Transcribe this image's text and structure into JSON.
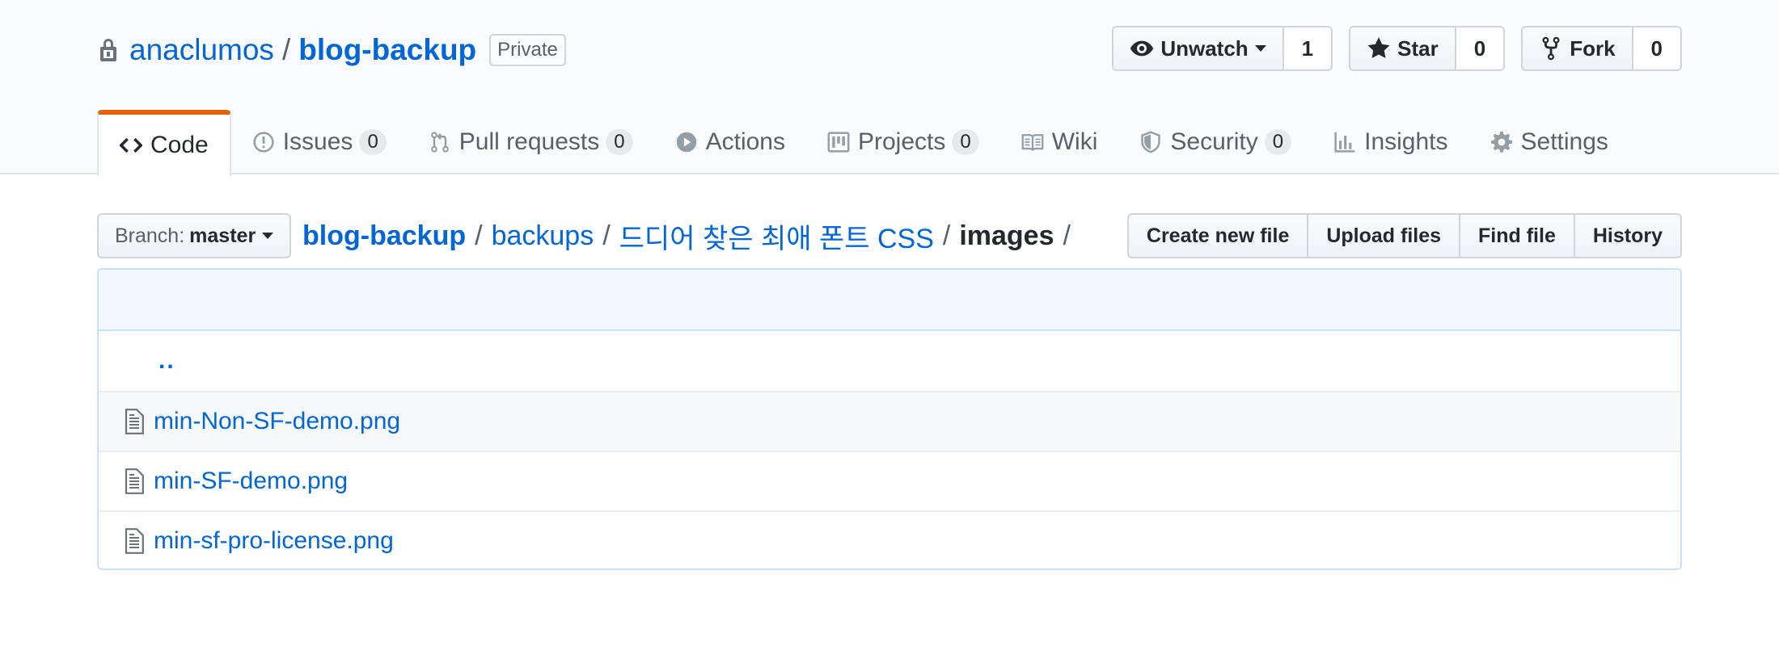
{
  "repo": {
    "owner": "anaclumos",
    "separator": "/",
    "name": "blog-backup",
    "visibility": "Private"
  },
  "actions": {
    "watch_label": "Unwatch",
    "watch_count": "1",
    "star_label": "Star",
    "star_count": "0",
    "fork_label": "Fork",
    "fork_count": "0"
  },
  "nav": {
    "tabs": [
      {
        "label": "Code",
        "icon": "code-icon",
        "selected": true
      },
      {
        "label": "Issues",
        "icon": "issue-icon",
        "count": "0"
      },
      {
        "label": "Pull requests",
        "icon": "pull-request-icon",
        "count": "0"
      },
      {
        "label": "Actions",
        "icon": "play-icon"
      },
      {
        "label": "Projects",
        "icon": "project-icon",
        "count": "0"
      },
      {
        "label": "Wiki",
        "icon": "book-icon"
      },
      {
        "label": "Security",
        "icon": "shield-icon",
        "count": "0"
      },
      {
        "label": "Insights",
        "icon": "graph-icon"
      },
      {
        "label": "Settings",
        "icon": "gear-icon"
      }
    ]
  },
  "file_nav": {
    "branch_prefix": "Branch:",
    "branch_name": "master",
    "breadcrumb": {
      "root": "blog-backup",
      "segments": [
        "backups",
        "드디어 찾은 최애 폰트 CSS"
      ],
      "final": "images",
      "separator": "/"
    },
    "buttons": {
      "create": "Create new file",
      "upload": "Upload files",
      "find": "Find file",
      "history": "History"
    }
  },
  "files": {
    "up": "..",
    "items": [
      {
        "name": "min-Non-SF-demo.png",
        "icon": "file-icon"
      },
      {
        "name": "min-SF-demo.png",
        "icon": "file-icon"
      },
      {
        "name": "min-sf-pro-license.png",
        "icon": "file-icon"
      }
    ]
  },
  "colors": {
    "link": "#0366d6",
    "selected_tab_accent": "#e36209",
    "commit_tease_bg": "#f1f8ff",
    "header_bg": "#fafbfc"
  }
}
